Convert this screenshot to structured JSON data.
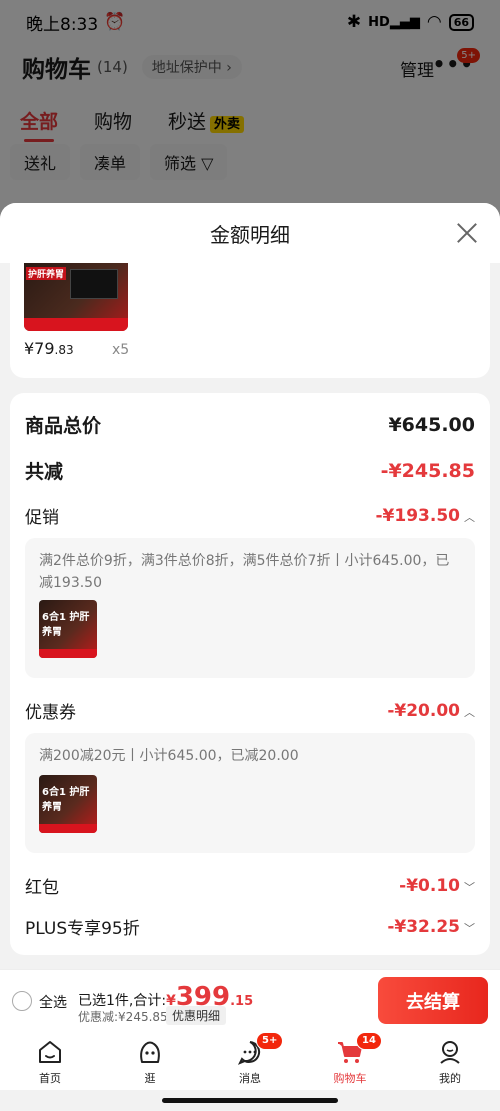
{
  "status_bar": {
    "time": "晚上8:33",
    "signal": "HD",
    "battery": "66"
  },
  "cart_page": {
    "title": "购物车",
    "count": "(14)",
    "address_label": "地址保护中",
    "manage": "管理",
    "more_badge": "5+",
    "tabs": [
      {
        "label": "全部",
        "active": true
      },
      {
        "label": "购物",
        "active": false
      },
      {
        "label": "秒送",
        "tag": "外卖",
        "active": false
      }
    ],
    "filters": [
      "送礼",
      "凑单",
      "筛选"
    ]
  },
  "sheet": {
    "title": "金额明细",
    "product": {
      "image_caption": "护肝养胃",
      "price_int": "¥79",
      "price_dec": ".83",
      "qty": "x5"
    },
    "total_label": "商品总价",
    "total_value": "¥645.00",
    "reduce_label": "共减",
    "reduce_value": "-¥245.85",
    "promo": {
      "label": "促销",
      "value": "-¥193.50",
      "detail": "满2件总价9折，满3件总价8折，满5件总价7折丨小计645.00，已减193.50",
      "thumb_caption": "6合1 护肝养胃"
    },
    "coupon": {
      "label": "优惠券",
      "value": "-¥20.00",
      "detail": "满200减20元丨小计645.00，已减20.00",
      "thumb_caption": "6合1 护肝养胃"
    },
    "redpacket": {
      "label": "红包",
      "value": "-¥0.10"
    },
    "plus": {
      "label": "PLUS专享95折",
      "value": "-¥32.25"
    }
  },
  "checkout": {
    "select_all": "全选",
    "selected_text": "已选1件,合计:",
    "currency": "¥",
    "total_int": "399",
    "total_dec": ".15",
    "discount_text": "优惠减:¥245.85",
    "detail_link": "优惠明细",
    "button": "去结算"
  },
  "tabbar": [
    {
      "label": "首页",
      "icon": "home-icon"
    },
    {
      "label": "逛",
      "icon": "browse-icon"
    },
    {
      "label": "消息",
      "icon": "message-icon",
      "badge": "5+"
    },
    {
      "label": "购物车",
      "icon": "cart-icon",
      "badge": "14",
      "active": true
    },
    {
      "label": "我的",
      "icon": "profile-icon"
    }
  ],
  "colors": {
    "accent": "#e4393c",
    "button": "#f0281e",
    "overlay": "rgba(0,0,0,0.48)"
  }
}
